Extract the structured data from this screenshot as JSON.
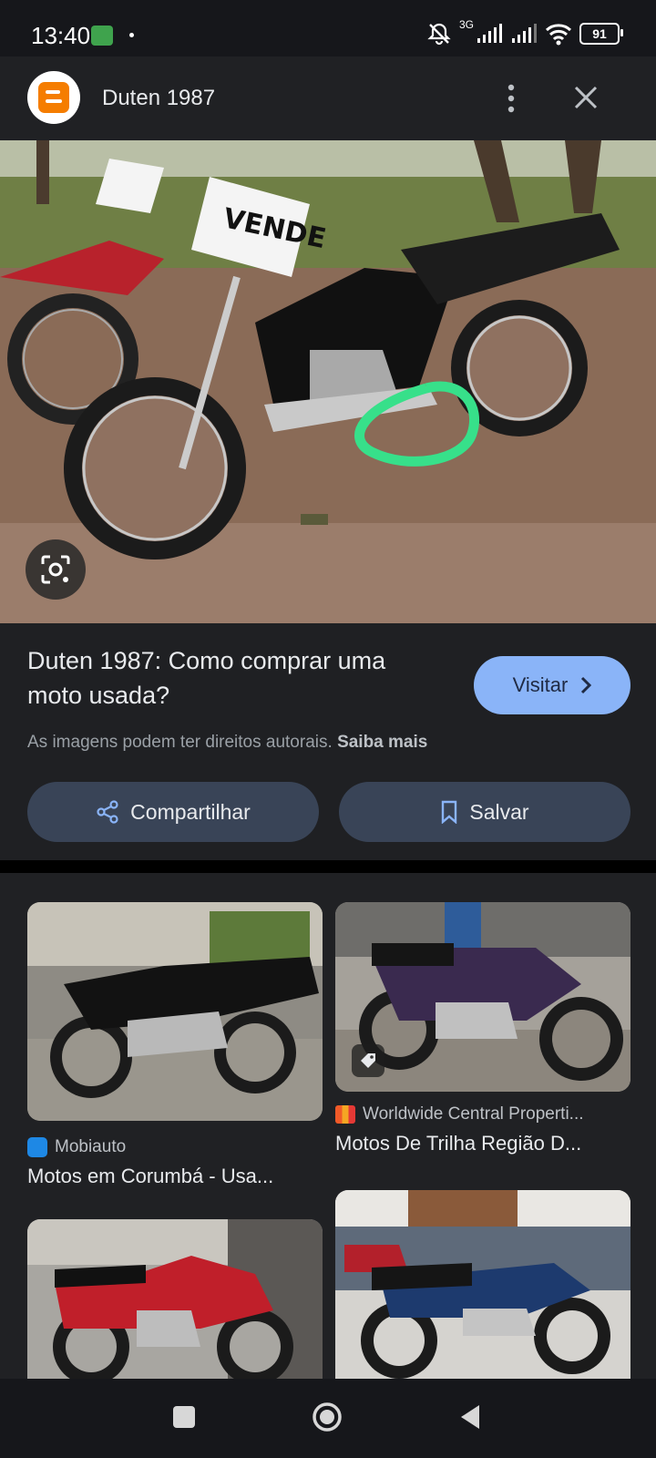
{
  "status_bar": {
    "time": "13:40",
    "network": "3G",
    "battery": "91"
  },
  "header": {
    "site_logo_icon": "blogger-logo-icon",
    "title": "Duten 1987",
    "more_icon": "more-vert-icon",
    "close_icon": "close-icon"
  },
  "hero": {
    "sign_text": "VENDE",
    "lens_icon": "google-lens-icon",
    "highlight_color": "#37e08a"
  },
  "result": {
    "title": "Duten 1987: Como comprar uma moto usada?",
    "visit_label": "Visitar",
    "copyright_text": "As imagens podem ter direitos autorais.",
    "learn_more": "Saiba mais",
    "share_label": "Compartilhar",
    "save_label": "Salvar",
    "accent": "#8ab4f8"
  },
  "related": [
    {
      "source": "Mobiauto",
      "title": "Motos em Corumbá - Usa..."
    },
    {
      "source": "Worldwide Central Properti...",
      "title": "Motos De Trilha Região D..."
    },
    {
      "source": "",
      "title": ""
    },
    {
      "source": "",
      "title": ""
    }
  ],
  "nav": {
    "recents_icon": "recents-icon",
    "home_icon": "home-icon",
    "back_icon": "back-icon"
  }
}
